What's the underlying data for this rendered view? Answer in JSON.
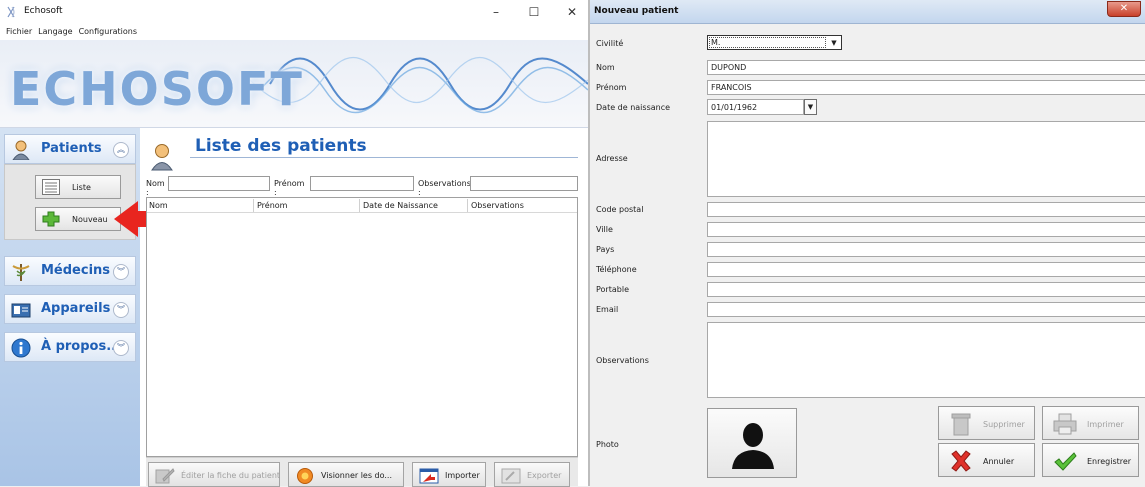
{
  "main_window": {
    "title": "Echosoft",
    "menu": [
      "Fichier",
      "Langage",
      "Configurations"
    ],
    "window_controls": {
      "minimize": "–",
      "maximize": "☐",
      "close": "✕"
    }
  },
  "banner": {
    "logo_text": "ECHOSOFT"
  },
  "sidebar": {
    "sections": [
      {
        "label": "Patients",
        "expanded": true,
        "icon": "patient-icon"
      },
      {
        "label": "Médecins",
        "expanded": false,
        "icon": "caduceus-icon"
      },
      {
        "label": "Appareils",
        "expanded": false,
        "icon": "device-icon"
      },
      {
        "label": "À propos...",
        "expanded": false,
        "icon": "info-icon"
      }
    ],
    "patients_actions": [
      {
        "label": "Liste",
        "icon": "list-icon"
      },
      {
        "label": "Nouveau",
        "icon": "plus-icon"
      }
    ],
    "highlight_color": "#e8251f"
  },
  "patient_list": {
    "title": "Liste des patients",
    "filters": {
      "nom_label": "Nom :",
      "prenom_label": "Prénom :",
      "observations_label": "Observations :",
      "nom_value": "",
      "prenom_value": "",
      "observations_value": ""
    },
    "columns": [
      "Nom",
      "Prénom",
      "Date de Naissance",
      "Observations"
    ],
    "rows": [],
    "actions": [
      {
        "label": "Éditer la fiche du patient",
        "enabled": false
      },
      {
        "label": "Visionner les do...",
        "enabled": true
      },
      {
        "label": "Importer",
        "enabled": true
      },
      {
        "label": "Exporter",
        "enabled": false
      }
    ]
  },
  "dialog": {
    "title": "Nouveau patient",
    "close": "✕",
    "fields": {
      "civilite": {
        "label": "Civilité",
        "value": "M."
      },
      "nom": {
        "label": "Nom",
        "value": "DUPOND"
      },
      "prenom": {
        "label": "Prénom",
        "value": "FRANCOIS"
      },
      "date_naissance": {
        "label": "Date de naissance",
        "value": "01/01/1962"
      },
      "adresse": {
        "label": "Adresse",
        "value": ""
      },
      "code_postal": {
        "label": "Code postal",
        "value": ""
      },
      "ville": {
        "label": "Ville",
        "value": ""
      },
      "pays": {
        "label": "Pays",
        "value": ""
      },
      "telephone": {
        "label": "Téléphone",
        "value": ""
      },
      "portable": {
        "label": "Portable",
        "value": ""
      },
      "email": {
        "label": "Email",
        "value": ""
      },
      "observations": {
        "label": "Observations",
        "value": ""
      },
      "photo": {
        "label": "Photo"
      }
    },
    "buttons": {
      "supprimer": {
        "label": "Supprimer",
        "enabled": false
      },
      "imprimer": {
        "label": "Imprimer",
        "enabled": false
      },
      "annuler": {
        "label": "Annuler",
        "enabled": true
      },
      "enregistrer": {
        "label": "Enregistrer",
        "enabled": true
      }
    }
  }
}
